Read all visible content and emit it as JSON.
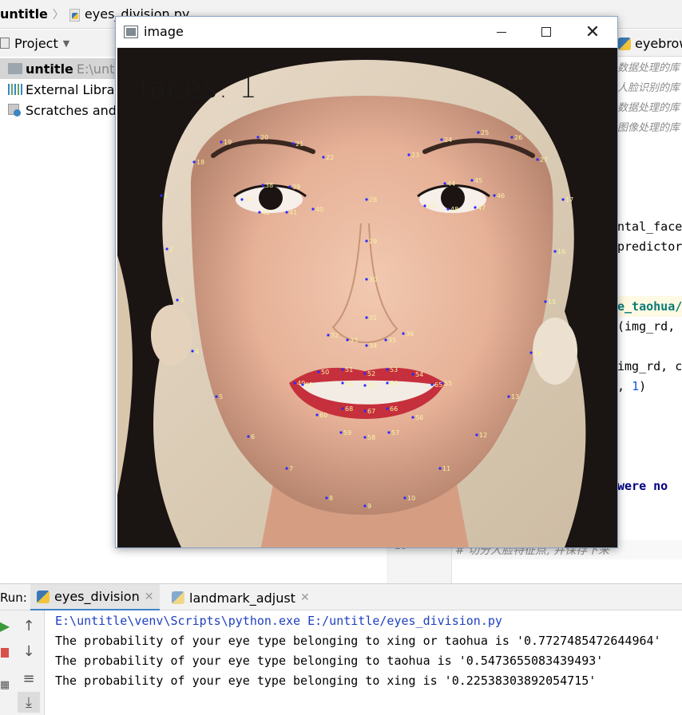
{
  "breadcrumb": {
    "project": "untitle",
    "file": "eyes_division.py"
  },
  "project_panel": {
    "title": "Project",
    "root": {
      "name": "untitle",
      "path": "E:\\untitle"
    },
    "items": [
      {
        "label": "External Libraries"
      },
      {
        "label": "Scratches and Consoles"
      }
    ]
  },
  "editor": {
    "tab_label": "eyebrow",
    "comments": [
      "数据处理的库",
      "人脸识别的库",
      "数据处理的库",
      "图像处理的库"
    ],
    "code": {
      "line1": "ntal_face",
      "line2": "predictor",
      "line3": "e_taohua/",
      "line4": "(img_rd, ",
      "line5": "img_rd, c",
      "line6_prefix": ", ",
      "line6_num": "1",
      "line6_suffix": ")",
      "line7": "were no"
    },
    "footer_line_number": "29",
    "footer_comment": "# 切分人脸特征点, 并保存下来"
  },
  "run_panel": {
    "label": "Run:",
    "tabs": [
      {
        "label": "eyes_division",
        "active": true
      },
      {
        "label": "landmark_adjust",
        "active": false
      }
    ],
    "console": [
      "E:\\untitle\\venv\\Scripts\\python.exe E:/untitle/eyes_division.py",
      "The probability of your eye type belonging to xing or taohua is '0.7727485472644964'",
      "The probability of your eye type belonging to taohua is '0.5473655083439493'",
      "The probability of your eye type belonging to xing is '0.22538303892054715'"
    ]
  },
  "image_window": {
    "title": "image",
    "overlay_text": "faces: 1",
    "landmark_labels": [
      "1",
      "2",
      "3",
      "4",
      "5",
      "6",
      "7",
      "8",
      "9",
      "10",
      "11",
      "12",
      "13",
      "14",
      "15",
      "16",
      "17",
      "18",
      "19",
      "20",
      "21",
      "22",
      "23",
      "24",
      "25",
      "26",
      "27",
      "28",
      "29",
      "30",
      "31",
      "32",
      "33",
      "34",
      "35",
      "36",
      "37",
      "38",
      "39",
      "40",
      "41",
      "42",
      "43",
      "44",
      "45",
      "46",
      "47",
      "48",
      "49",
      "50",
      "51",
      "52",
      "53",
      "54",
      "55",
      "56",
      "57",
      "58",
      "59",
      "60",
      "61",
      "62",
      "63",
      "64",
      "65",
      "66",
      "67",
      "68"
    ]
  },
  "colors": {
    "accent": "#4083c9",
    "console_path": "#1f3fbf",
    "landmark": "#2a2aff"
  }
}
